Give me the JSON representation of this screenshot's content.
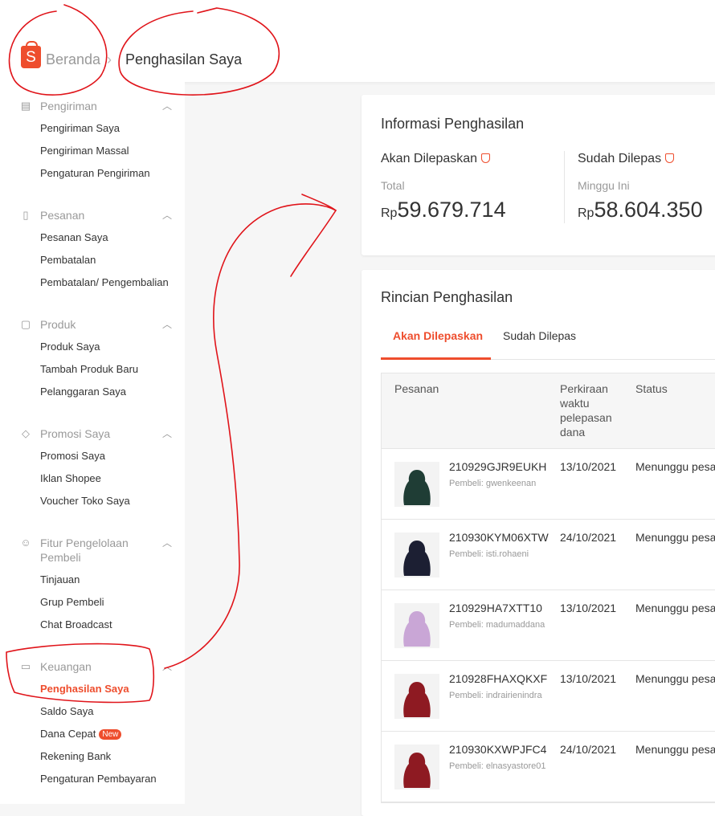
{
  "header": {
    "logo_letter": "S",
    "breadcrumb_home": "Beranda",
    "breadcrumb_separator": "›",
    "breadcrumb_current": "Penghasilan Saya"
  },
  "sidebar": {
    "sections": [
      {
        "title": "Pengiriman",
        "icon": "truck-icon",
        "items": [
          "Pengiriman Saya",
          "Pengiriman Massal",
          "Pengaturan Pengiriman"
        ]
      },
      {
        "title": "Pesanan",
        "icon": "clipboard-icon",
        "items": [
          "Pesanan Saya",
          "Pembatalan",
          "Pembatalan/ Pengembalian"
        ]
      },
      {
        "title": "Produk",
        "icon": "bag-icon",
        "items": [
          "Produk Saya",
          "Tambah Produk Baru",
          "Pelanggaran Saya"
        ]
      },
      {
        "title": "Promosi Saya",
        "icon": "tag-icon",
        "items": [
          "Promosi Saya",
          "Iklan Shopee",
          "Voucher Toko Saya"
        ]
      },
      {
        "title": "Fitur Pengelolaan Pembeli",
        "icon": "users-icon",
        "items": [
          "Tinjauan",
          "Grup Pembeli",
          "Chat Broadcast"
        ]
      },
      {
        "title": "Keuangan",
        "icon": "wallet-icon",
        "items": [
          "Penghasilan Saya",
          "Saldo Saya",
          "Dana Cepat",
          "Rekening Bank",
          "Pengaturan Pembayaran"
        ]
      }
    ],
    "new_badge": "New"
  },
  "info": {
    "title": "Informasi Penghasilan",
    "pending_label": "Akan Dilepaskan",
    "pending_sub": "Total",
    "pending_currency": "Rp",
    "pending_amount": "59.679.714",
    "released_label": "Sudah Dilepas",
    "released_sub": "Minggu Ini",
    "released_currency": "Rp",
    "released_amount": "58.604.350"
  },
  "details": {
    "title": "Rincian Penghasilan",
    "tabs": [
      "Akan Dilepaskan",
      "Sudah Dilepas"
    ],
    "columns": {
      "order": "Pesanan",
      "estimate": "Perkiraan waktu pelepasan dana",
      "status": "Status"
    },
    "rows": [
      {
        "order_id": "210929GJR9EUKH",
        "buyer": "Pembeli: gwenkeenan",
        "date": "13/10/2021",
        "status": "Menunggu pesa",
        "thumb_color": "#1f3d35"
      },
      {
        "order_id": "210930KYM06XTW",
        "buyer": "Pembeli: isti.rohaeni",
        "date": "24/10/2021",
        "status": "Menunggu pesa",
        "thumb_color": "#1c1f33"
      },
      {
        "order_id": "210929HA7XTT10",
        "buyer": "Pembeli: madumaddana",
        "date": "13/10/2021",
        "status": "Menunggu pesa",
        "thumb_color": "#c9a6d6"
      },
      {
        "order_id": "210928FHAXQKXF",
        "buyer": "Pembeli: indrairienindra",
        "date": "13/10/2021",
        "status": "Menunggu pesa",
        "thumb_color": "#8e1a22"
      },
      {
        "order_id": "210930KXWPJFC4",
        "buyer": "Pembeli: elnasyastore01",
        "date": "24/10/2021",
        "status": "Menunggu pesa",
        "thumb_color": "#8e1a22"
      }
    ]
  },
  "colors": {
    "accent": "#ee4d2d",
    "annotation": "#e0141a"
  }
}
